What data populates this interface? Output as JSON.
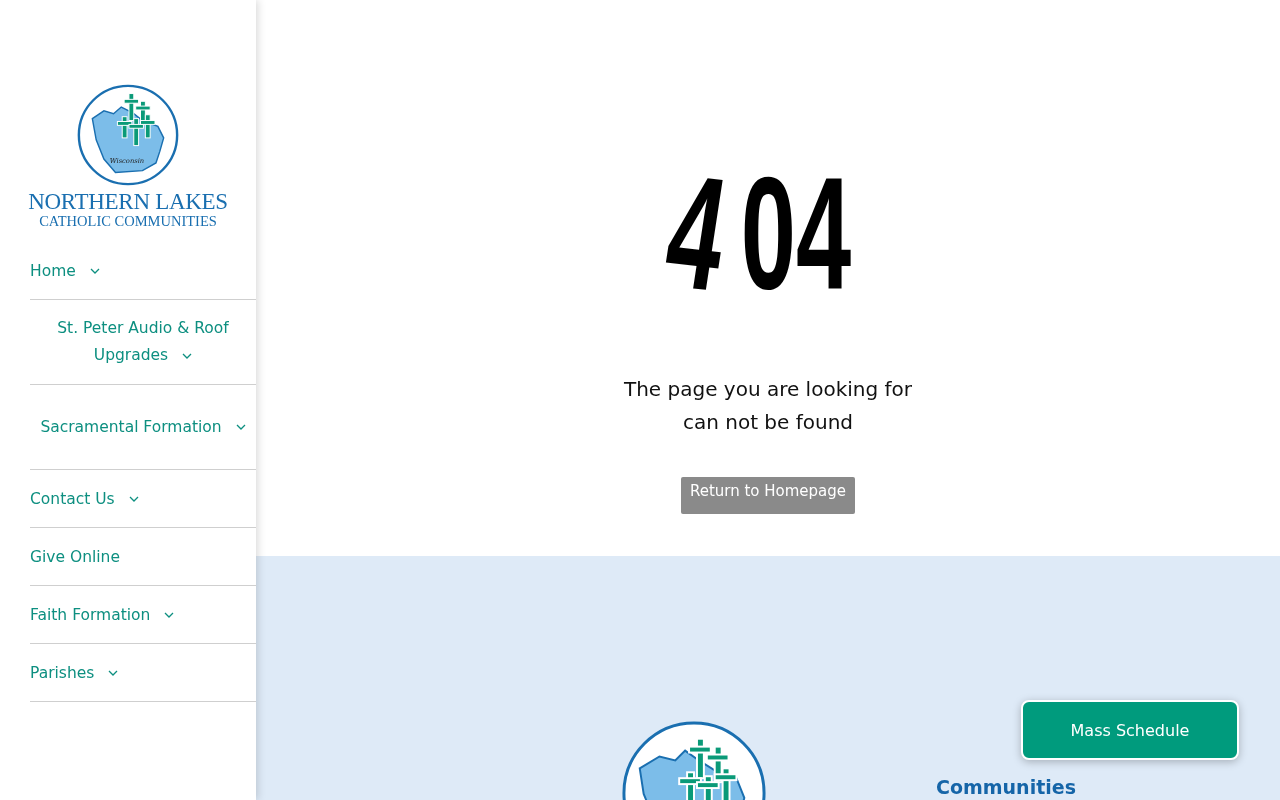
{
  "sidebar": {
    "logo": {
      "script": "Wisconsin",
      "title": "NORTHERN LAKES",
      "subtitle": "CATHOLIC COMMUNITIES"
    },
    "nav": [
      {
        "label": "Home",
        "has_menu": true,
        "kind": "inline"
      },
      {
        "label": "St. Peter Audio & Roof Upgrades",
        "has_menu": true,
        "kind": "centered"
      },
      {
        "label": "Sacramental Formation",
        "has_menu": true,
        "kind": "centered"
      },
      {
        "label": "Contact Us",
        "has_menu": true,
        "kind": "inline"
      },
      {
        "label": "Give Online",
        "has_menu": false,
        "kind": "inline"
      },
      {
        "label": "Faith Formation",
        "has_menu": true,
        "kind": "inline"
      },
      {
        "label": "Parishes",
        "has_menu": true,
        "kind": "inline"
      }
    ]
  },
  "error": {
    "code_parts": [
      "4",
      "04"
    ],
    "message_lines": [
      "The page you are looking for",
      "can not be found"
    ],
    "button": "Return to Homepage"
  },
  "footer": {
    "title_lines": [
      "Communities"
    ]
  },
  "floating_button": "Mass Schedule"
}
